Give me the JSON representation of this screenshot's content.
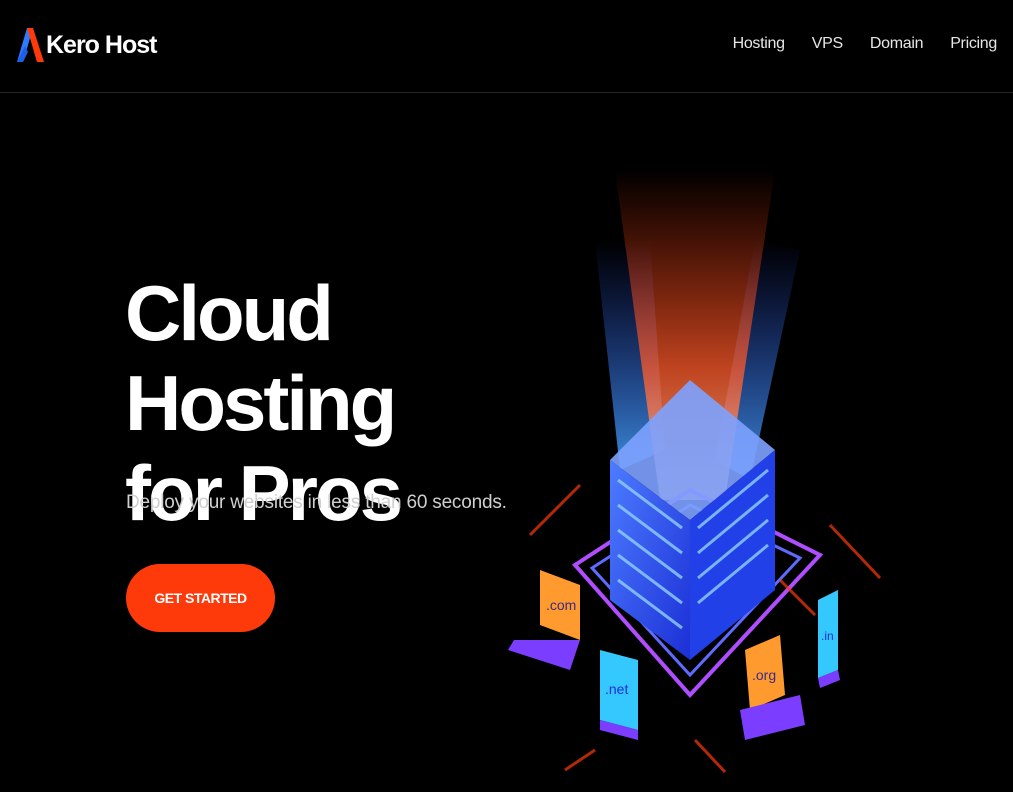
{
  "brand": {
    "name": "Kero Host",
    "logo_icon": "kero-logo-icon"
  },
  "nav": {
    "items": [
      "Hosting",
      "VPS",
      "Domain",
      "Pricing"
    ]
  },
  "hero": {
    "title_line1": "Cloud Hosting",
    "title_line2": "for Pros",
    "subtitle": "Deploy your websites in less than 60 seconds.",
    "cta_label": "GET STARTED"
  },
  "illustration": {
    "icon": "server-cluster-illustration",
    "domain_labels": [
      ".com",
      ".net",
      ".org",
      ".in"
    ]
  },
  "colors": {
    "background": "#000000",
    "accent": "#ff3a0a",
    "server_blue": "#2f56ff",
    "device_purple": "#7b3dff",
    "screen_orange": "#ff9a2e",
    "screen_cyan": "#35c8ff"
  }
}
